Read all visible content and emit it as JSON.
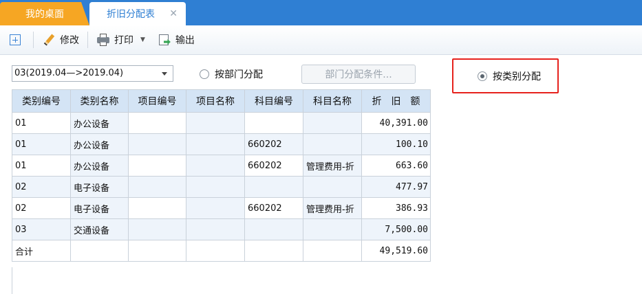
{
  "tabs": {
    "home": "我的桌面",
    "active": "折旧分配表",
    "close": "✕"
  },
  "toolbar": {
    "edit": "修改",
    "print": "打印",
    "export": "输出"
  },
  "options": {
    "period": "03(2019.04—>2019.04)",
    "by_department": "按部门分配",
    "dept_condition_button": "部门分配条件...",
    "by_category": "按类别分配",
    "selected": "by_category"
  },
  "table": {
    "headers": [
      "类别编号",
      "类别名称",
      "项目编号",
      "项目名称",
      "科目编号",
      "科目名称",
      "折　旧　额"
    ],
    "rows": [
      [
        "01",
        "办公设备",
        "",
        "",
        "",
        "",
        "40,391.00"
      ],
      [
        "01",
        "办公设备",
        "",
        "",
        "660202",
        "",
        "100.10"
      ],
      [
        "01",
        "办公设备",
        "",
        "",
        "660202",
        "管理费用-折",
        "663.60"
      ],
      [
        "02",
        "电子设备",
        "",
        "",
        "",
        "",
        "477.97"
      ],
      [
        "02",
        "电子设备",
        "",
        "",
        "660202",
        "管理费用-折",
        "386.93"
      ],
      [
        "03",
        "交通设备",
        "",
        "",
        "",
        "",
        "7,500.00"
      ],
      [
        "合计",
        "",
        "",
        "",
        "",
        "",
        "49,519.60"
      ]
    ]
  },
  "colors": {
    "tabbar": "#2f7fd3",
    "home_tab": "#f6a623",
    "header_bg": "#d4e4f5",
    "highlight": "#e6211c"
  }
}
